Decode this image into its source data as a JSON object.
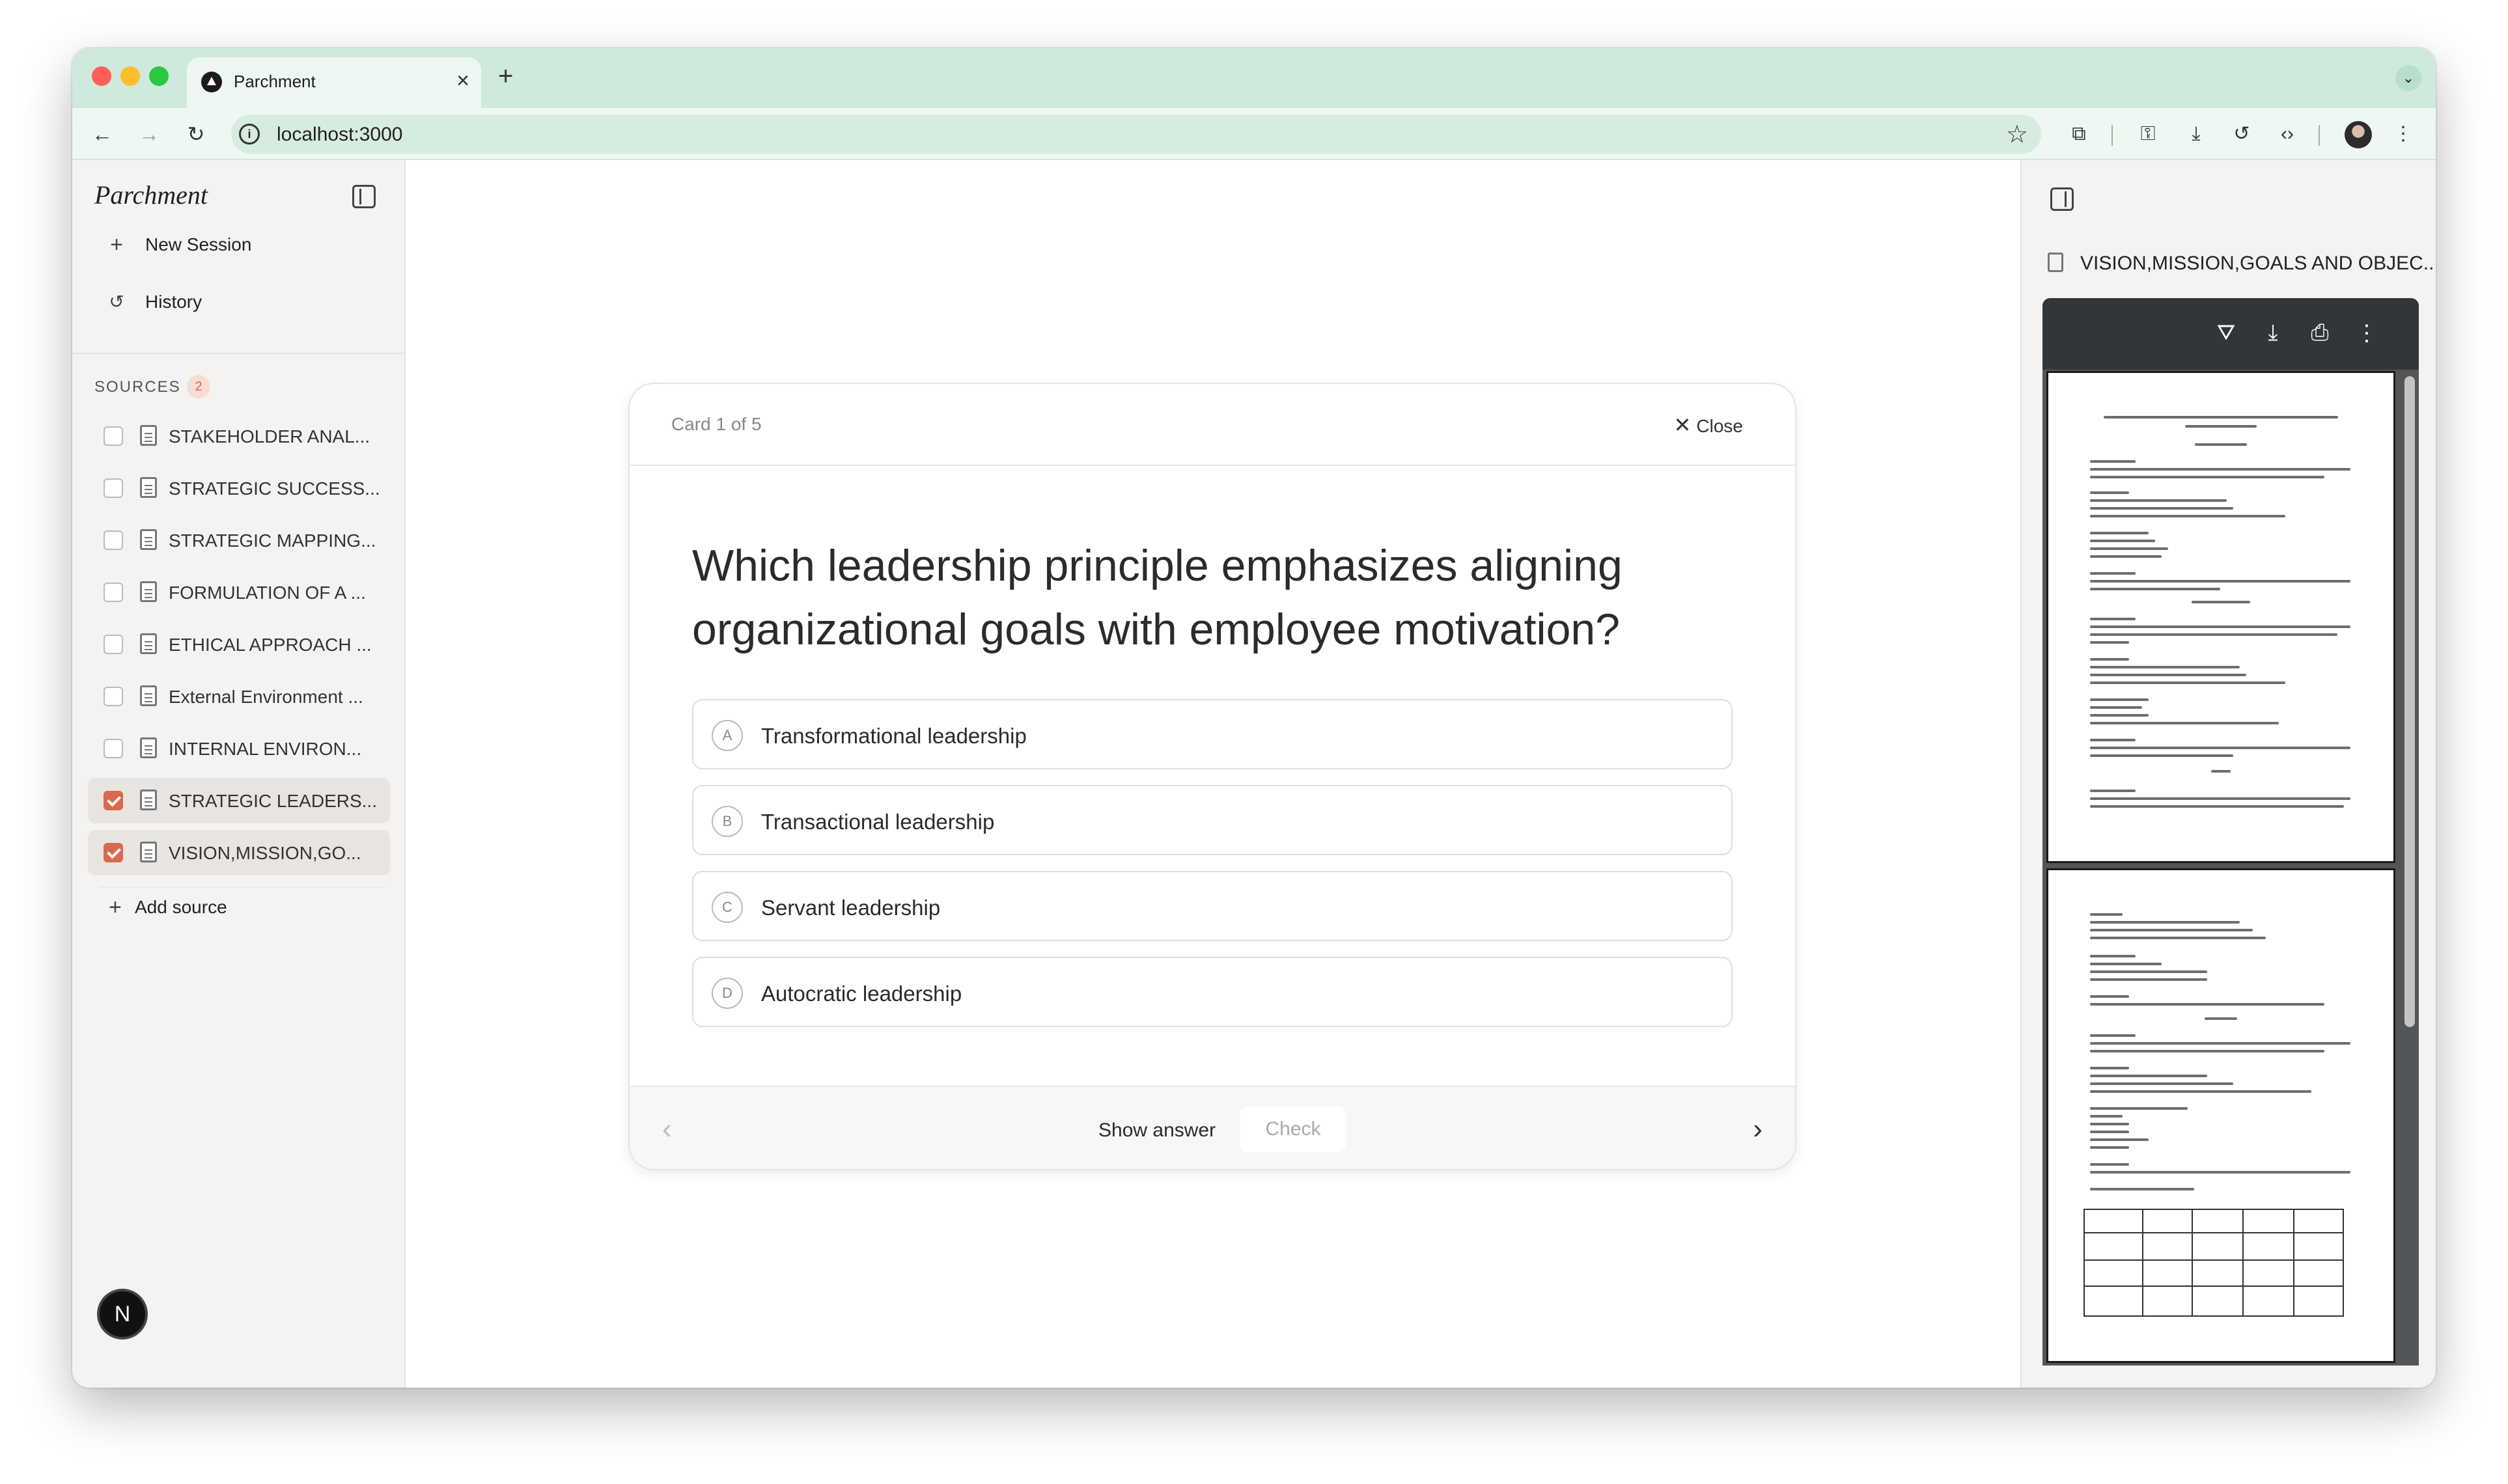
{
  "browser": {
    "tab_title": "Parchment",
    "url": "localhost:3000"
  },
  "sidebar": {
    "brand": "Parchment",
    "nav": [
      {
        "label": "New Session",
        "icon": "plus-icon"
      },
      {
        "label": "History",
        "icon": "history-icon"
      }
    ],
    "sources_heading": "SOURCES",
    "sources_count": "2",
    "sources": [
      {
        "title": "STAKEHOLDER ANAL...",
        "checked": false
      },
      {
        "title": "STRATEGIC SUCCESS...",
        "checked": false
      },
      {
        "title": "STRATEGIC MAPPING...",
        "checked": false
      },
      {
        "title": "FORMULATION OF A ...",
        "checked": false
      },
      {
        "title": "ETHICAL APPROACH ...",
        "checked": false
      },
      {
        "title": "External Environment ...",
        "checked": false
      },
      {
        "title": "INTERNAL ENVIRON...",
        "checked": false
      },
      {
        "title": "STRATEGIC LEADERS...",
        "checked": true
      },
      {
        "title": "VISION,MISSION,GO...",
        "checked": true
      }
    ],
    "add_source": "Add source",
    "user_initial": "N"
  },
  "flashcard": {
    "counter": "Card 1 of 5",
    "close_label": "Close",
    "question": "Which leadership principle emphasizes aligning organizational goals with employee motivation?",
    "options": [
      {
        "letter": "A",
        "text": "Transformational leadership"
      },
      {
        "letter": "B",
        "text": "Transactional leadership"
      },
      {
        "letter": "C",
        "text": "Servant leadership"
      },
      {
        "letter": "D",
        "text": "Autocratic leadership"
      }
    ],
    "show_answer_label": "Show answer",
    "check_label": "Check"
  },
  "viewer": {
    "document_title": "VISION,MISSION,GOALS AND OBJEC..."
  },
  "colors": {
    "accent": "#d9694e",
    "tabbar": "#cfe9dd"
  }
}
